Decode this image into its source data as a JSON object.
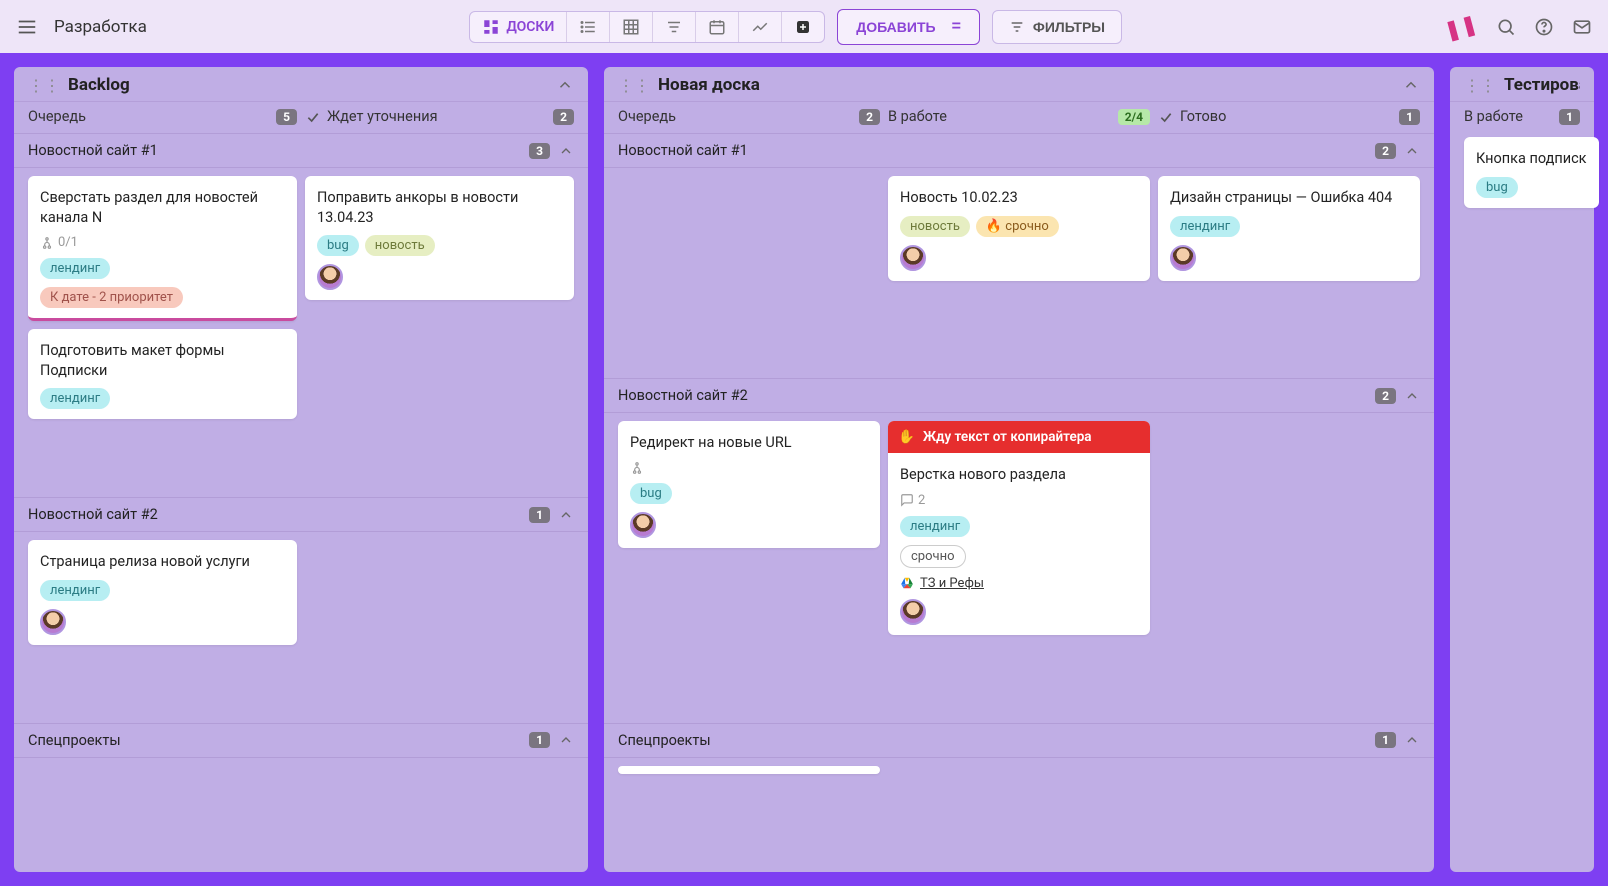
{
  "header": {
    "title": "Разработка",
    "active_view": "ДОСКИ",
    "add_label": "ДОБАВИТЬ",
    "filters_label": "ФИЛЬТРЫ"
  },
  "tags": {
    "landing": "лендинг",
    "bug": "bug",
    "news": "новость",
    "urgent": "срочно",
    "date_priority": "К дате - 2 приоритет"
  },
  "boards": {
    "backlog": {
      "title": "Backlog",
      "columns": [
        {
          "label": "Очередь",
          "count": "5"
        },
        {
          "label": "Ждет уточнения",
          "count": "2",
          "check": true
        }
      ],
      "sections": {
        "s1": {
          "title": "Новостной сайт #1",
          "count": "3",
          "cards": {
            "c1": {
              "title": "Сверстать раздел для новостей канала N",
              "subtask": "0/1"
            },
            "c2": {
              "title": "Подготовить макет формы Подписки"
            },
            "c3": {
              "title": "Поправить анкоры в новости 13.04.23"
            }
          }
        },
        "s2": {
          "title": "Новостной сайт #2",
          "count": "1",
          "cards": {
            "c1": {
              "title": "Страница релиза новой услуги"
            }
          }
        },
        "s3": {
          "title": "Спецпроекты",
          "count": "1"
        }
      }
    },
    "newboard": {
      "title": "Новая доска",
      "columns": [
        {
          "label": "Очередь",
          "count": "2"
        },
        {
          "label": "В работе",
          "count": "2/4",
          "green": true
        },
        {
          "label": "Готово",
          "count": "1",
          "check": true
        }
      ],
      "sections": {
        "s1": {
          "title": "Новостной сайт #1",
          "count": "2",
          "cards": {
            "work1": {
              "title": "Новость 10.02.23"
            },
            "done1": {
              "title": "Дизайн страницы — Ошибка 404"
            }
          }
        },
        "s2": {
          "title": "Новостной сайт #2",
          "count": "2",
          "cards": {
            "q1": {
              "title": "Редирект на новые URL"
            },
            "work1": {
              "blocked": "Жду текст от копирайтера",
              "title": "Верстка нового раздела",
              "comments": "2",
              "attach": "ТЗ и Рефы"
            }
          }
        },
        "s3": {
          "title": "Спецпроекты",
          "count": "1"
        }
      }
    },
    "testing": {
      "title": "Тестирование",
      "columns": [
        {
          "label": "В работе",
          "count": "1"
        }
      ],
      "sections": {
        "s1": {
          "cards": {
            "c1": {
              "title": "Кнопка подписк"
            }
          }
        }
      }
    }
  }
}
